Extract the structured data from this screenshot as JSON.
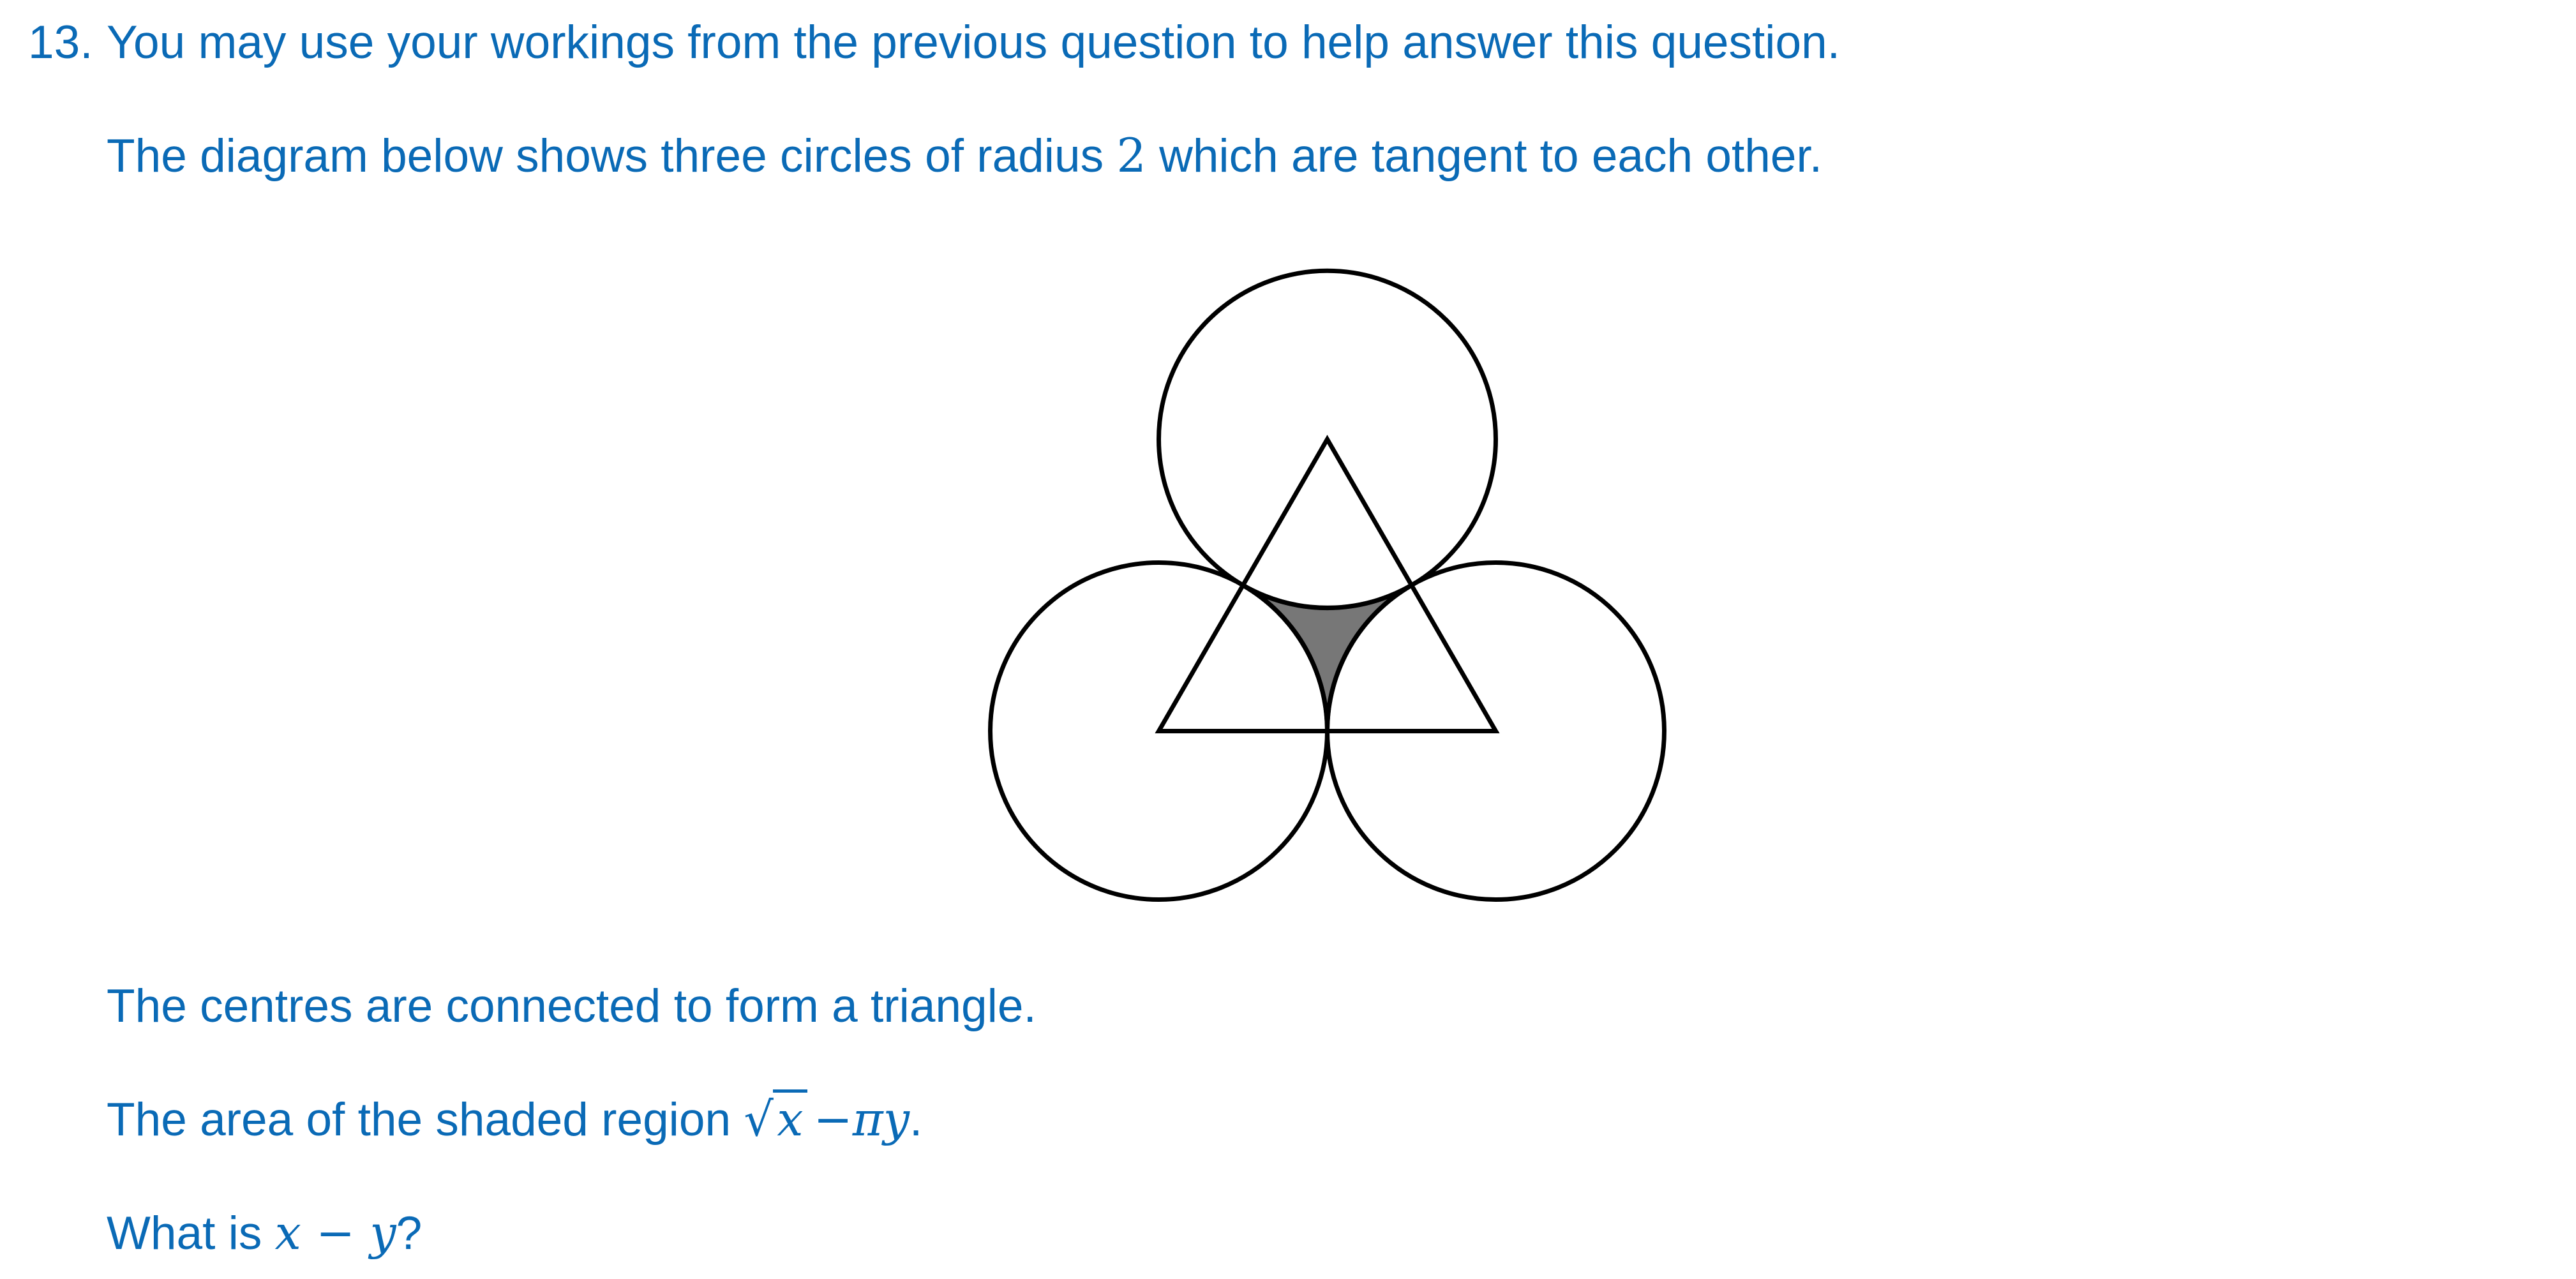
{
  "question": {
    "number": "13.",
    "intro": "You may use your workings from the previous question to help answer this question.",
    "desc_before": "The diagram below shows three circles of radius ",
    "radius": "2",
    "desc_after": " which are tangent to each other.",
    "centres_text": "The centres are connected to form a triangle.",
    "area_text": "The area of the shaded region ",
    "area_expr": {
      "sqrt_var": "x",
      "minus": "−",
      "pi_term": "πy",
      "end": "."
    },
    "ask_text": "What is ",
    "ask_expr": {
      "x": "x",
      "minus": " − ",
      "y": "y",
      "end": "?"
    }
  },
  "diagram": {
    "circle_count": 3,
    "radius": 2,
    "colors": {
      "stroke": "#000000",
      "shade": "#777777",
      "text": "#0a6ab6"
    }
  }
}
